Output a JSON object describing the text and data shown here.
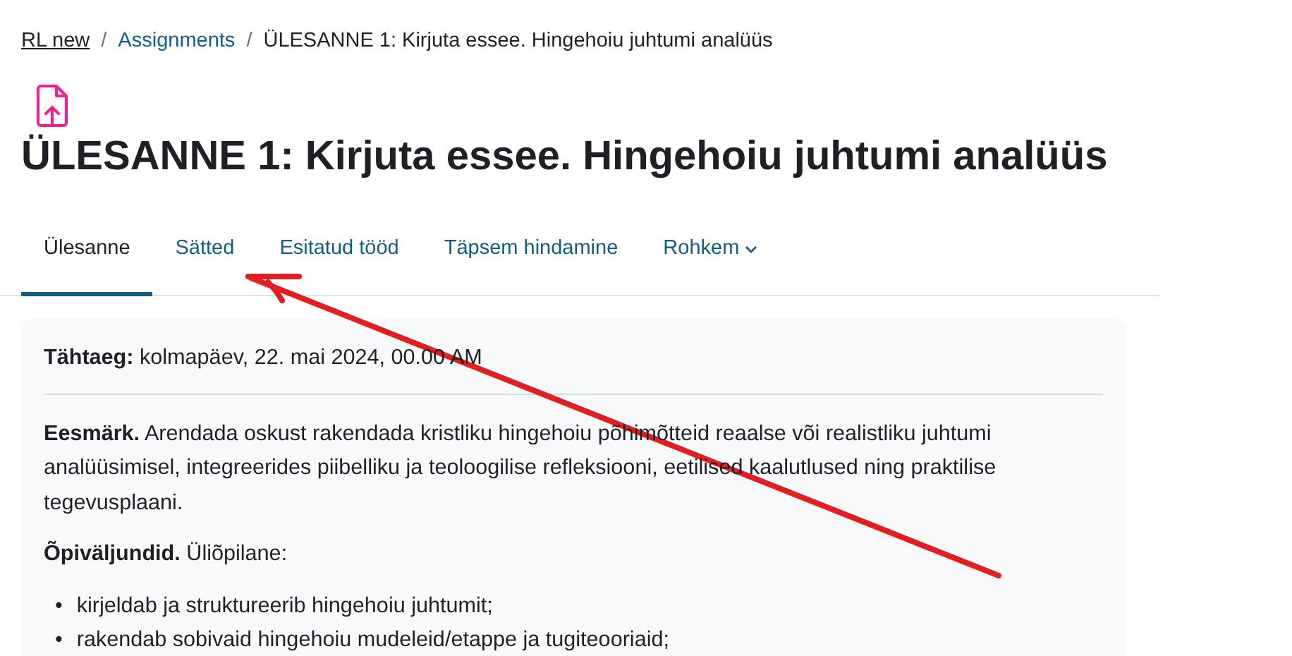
{
  "breadcrumb": [
    {
      "label": "RL new",
      "kind": "course"
    },
    {
      "label": "/",
      "kind": "separator"
    },
    {
      "label": "Assignments",
      "kind": "link"
    },
    {
      "label": "/",
      "kind": "separator"
    },
    {
      "label": "ÜLESANNE 1: Kirjuta essee. Hingehoiu juhtumi analüüs",
      "kind": "current"
    }
  ],
  "page_title": "ÜLESANNE 1: Kirjuta essee. Hingehoiu juhtumi analüüs",
  "tabs": [
    {
      "label": "Ülesanne",
      "selected": true,
      "kind": "tab"
    },
    {
      "label": "Sätted",
      "selected": false,
      "kind": "tab"
    },
    {
      "label": "Esitatud tööd",
      "selected": false,
      "kind": "tab"
    },
    {
      "label": "Täpsem hindamine",
      "selected": false,
      "kind": "tab"
    },
    {
      "label": "Rohkem",
      "selected": false,
      "kind": "dropdown"
    }
  ],
  "due": {
    "label": "Tähtaeg:",
    "value": "kolmapäev, 22. mai 2024, 00.00 AM"
  },
  "description": [
    {
      "kind": "paragraph",
      "text": "**Eesmärk.** Arendada oskust rakendada kristliku hingehoiu põhimõtteid reaalse või realistliku juhtumi analüüsimisel, integreerides piibelliku ja teoloogilise refleksiooni, eetilised kaalutlused ning praktilise tegevusplaani."
    },
    {
      "kind": "paragraph",
      "text": "**Õpiväljundid.** Üliõpilane:"
    },
    {
      "kind": "list",
      "items": [
        {
          "marker": "•",
          "text": "kirjeldab ja struktureerib hingehoiu juhtumit;"
        },
        {
          "marker": "•",
          "text": "rakendab sobivaid hingehoiu mudeleid/etappe ja tugiteooriaid;"
        }
      ]
    }
  ],
  "annotation": {
    "kind": "arrow"
  }
}
